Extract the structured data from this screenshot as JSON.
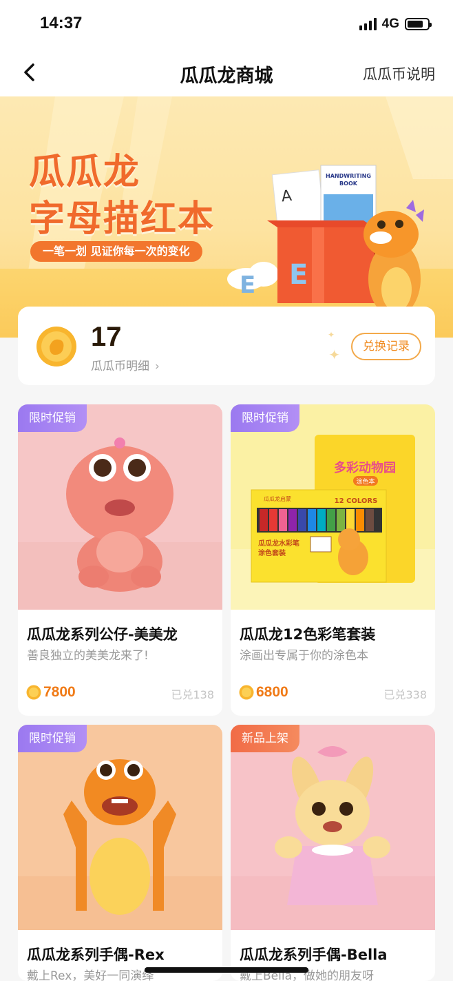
{
  "status": {
    "time": "14:37",
    "network": "4G",
    "battery_level": 0.8
  },
  "nav": {
    "title": "瓜瓜龙商城",
    "right_link": "瓜瓜币说明"
  },
  "banner": {
    "title_line1": "瓜瓜龙",
    "title_line2": "字母描红本",
    "slogan": "一笔一划 见证你每一次的变化",
    "book_text_line1": "HANDWRITING",
    "book_text_line2": "BOOK"
  },
  "coins": {
    "amount": "17",
    "detail_label": "瓜瓜币明细",
    "exchange_button": "兑换记录"
  },
  "products": [
    {
      "tag": "限时促销",
      "name": "瓜瓜龙系列公仔-美美龙",
      "desc": "善良独立的美美龙来了!",
      "price": "7800",
      "sold": "已兑138"
    },
    {
      "tag": "限时促销",
      "name": "瓜瓜龙12色彩笔套装",
      "desc": "涂画出专属于你的涂色本",
      "price": "6800",
      "sold": "已兑338",
      "box_title": "多彩动物园",
      "box_sub": "涂色本",
      "pen_count_label": "12 COLORS",
      "pen_brand": "瓜瓜龙启蒙",
      "pen_name_line1": "瓜瓜龙水彩笔",
      "pen_name_line2": "涂色套装"
    },
    {
      "tag": "限时促销",
      "name": "瓜瓜龙系列手偶-Rex",
      "desc": "戴上Rex，美好一同演绎"
    },
    {
      "tag": "新品上架",
      "name": "瓜瓜龙系列手偶-Bella",
      "desc": "戴上Bella，做她的朋友呀"
    }
  ],
  "colors": {
    "accent_orange": "#f07a16",
    "tag_purple": "#9b79f0",
    "tag_orange": "#f16b46"
  }
}
